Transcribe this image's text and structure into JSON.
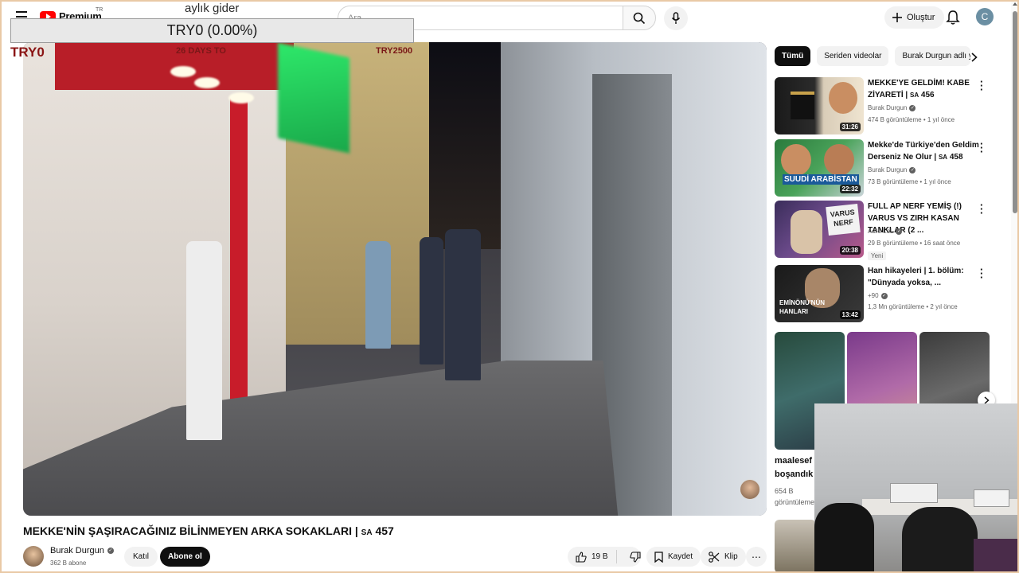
{
  "header": {
    "logo_text": "Premium",
    "country_code": "TR",
    "search_placeholder": "Ara",
    "create_label": "Oluştur",
    "account_initial": "C"
  },
  "overlay": {
    "title": "aylık gider",
    "value_text": "TRY0 (0.00%)",
    "left_text": "TRY0",
    "mid_text": "26 DAYS TO",
    "right_text": "TRY2500"
  },
  "video": {
    "title_main": "MEKKE'NİN ŞAŞIRACAĞINIZ BİLİNMEYEN ARKA SOKAKLARI | ",
    "title_sa": "SA",
    "title_num": " 457"
  },
  "channel": {
    "name": "Burak Durgun",
    "subs": "362 B abone",
    "join_label": "Katıl",
    "subscribe_label": "Abone ol"
  },
  "actions": {
    "like_count": "19 B",
    "save_label": "Kaydet",
    "clip_label": "Klip",
    "more_label": "⋯"
  },
  "chips": {
    "all": "Tümü",
    "series": "Seriden videolar",
    "channel": "Burak Durgun adlı yük"
  },
  "recommendations": [
    {
      "title": "MEKKE'YE GELDİM! KABE ZİYARETİ | ",
      "sa": "SA",
      "num": " 456",
      "channel": "Burak Durgun",
      "verified": true,
      "meta": "474 B görüntüleme • 1 yıl önce",
      "duration": "31:26"
    },
    {
      "title": "Mekke'de Türkiye'den Geldim Derseniz Ne Olur | ",
      "sa": "SA",
      "num": " 458",
      "channel": "Burak Durgun",
      "verified": true,
      "meta": "73 B görüntüleme • 1 yıl önce",
      "duration": "22:32",
      "thumb_text": "SUUDİ ARABİSTAN"
    },
    {
      "title": "FULL AP NERF YEMİŞ (!) VARUS VS ZIRH KASAN TANKLAR (2 ...",
      "sa": "",
      "num": "",
      "channel": "Adro LoL",
      "verified": true,
      "meta": "29 B görüntüleme • 16 saat önce",
      "badge": "Yeni",
      "duration": "20:38",
      "thumb_text": "VARUS NERF"
    },
    {
      "title": "Han hikayeleri | 1. bölüm: \"Dünyada yoksa, ...",
      "sa": "",
      "num": "",
      "channel": "+90",
      "verified": true,
      "meta": "1,3 Mn görüntüleme • 2 yıl önce",
      "duration": "13:42",
      "thumb_text": "EMİNÖNÜ'NÜN HANLARI"
    }
  ],
  "shorts": {
    "caption_line1": "maalesef",
    "caption_line2": "boşandık",
    "views_line1": "654 B",
    "views_line2": "görüntüleme"
  },
  "colors": {
    "youtube_red": "#ff0000",
    "overlay_red": "#8a1414",
    "subscribe_bg": "#0f0f0f"
  }
}
